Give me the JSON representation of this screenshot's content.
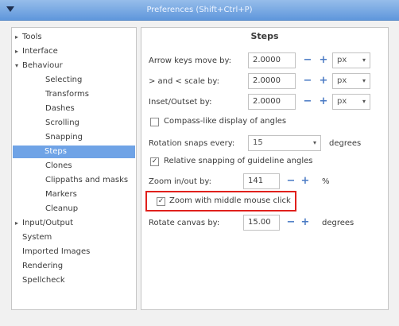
{
  "window": {
    "title": "Preferences (Shift+Ctrl+P)"
  },
  "sidebar": {
    "items": [
      {
        "label": "Tools",
        "arrow": "▸"
      },
      {
        "label": "Interface",
        "arrow": "▸"
      },
      {
        "label": "Behaviour",
        "arrow": "▾"
      },
      {
        "label": "Selecting"
      },
      {
        "label": "Transforms"
      },
      {
        "label": "Dashes"
      },
      {
        "label": "Scrolling"
      },
      {
        "label": "Snapping"
      },
      {
        "label": "Steps",
        "selected": true
      },
      {
        "label": "Clones"
      },
      {
        "label": "Clippaths and masks"
      },
      {
        "label": "Markers"
      },
      {
        "label": "Cleanup"
      },
      {
        "label": "Input/Output",
        "arrow": "▸"
      },
      {
        "label": "System"
      },
      {
        "label": "Imported Images"
      },
      {
        "label": "Rendering"
      },
      {
        "label": "Spellcheck"
      }
    ]
  },
  "steps": {
    "title": "Steps",
    "arrow_keys": {
      "label": "Arrow keys move by:",
      "value": "2.0000",
      "unit": "px"
    },
    "scale_by": {
      "label": "> and < scale by:",
      "value": "2.0000",
      "unit": "px"
    },
    "inset_outset": {
      "label": "Inset/Outset by:",
      "value": "2.0000",
      "unit": "px"
    },
    "compass": {
      "label": "Compass-like display of angles",
      "checked": false
    },
    "rotation_snaps": {
      "label": "Rotation snaps every:",
      "value": "15",
      "unit": "degrees"
    },
    "relative_snapping": {
      "label": "Relative snapping of guideline angles",
      "checked": true
    },
    "zoom_in_out": {
      "label": "Zoom in/out by:",
      "value": "141",
      "unit": "%"
    },
    "zoom_middle_click": {
      "label": "Zoom with middle mouse click",
      "checked": true
    },
    "rotate_canvas": {
      "label": "Rotate canvas by:",
      "value": "15.00",
      "unit": "degrees"
    }
  },
  "controls": {
    "minus": "−",
    "plus": "+",
    "check": "✓",
    "caret": "▾"
  }
}
